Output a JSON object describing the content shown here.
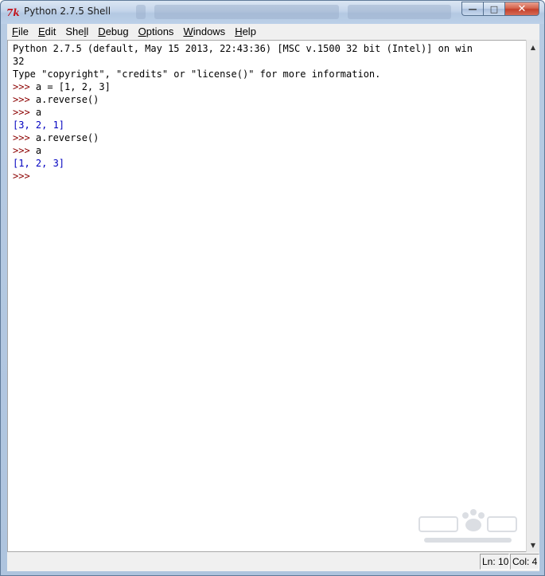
{
  "window": {
    "title": "Python 2.7.5 Shell",
    "icon": "tk-icon"
  },
  "menu": {
    "items": [
      {
        "label": "File",
        "mnemonic": "F",
        "rest": "ile"
      },
      {
        "label": "Edit",
        "mnemonic": "E",
        "rest": "dit"
      },
      {
        "label": "Shell",
        "pre": "She",
        "mnemonic": "l",
        "rest": "l"
      },
      {
        "label": "Debug",
        "mnemonic": "D",
        "rest": "ebug"
      },
      {
        "label": "Options",
        "mnemonic": "O",
        "rest": "ptions"
      },
      {
        "label": "Windows",
        "mnemonic": "W",
        "rest": "indows"
      },
      {
        "label": "Help",
        "mnemonic": "H",
        "rest": "elp"
      }
    ]
  },
  "shell": {
    "lines": [
      {
        "kind": "banner",
        "text": "Python 2.7.5 (default, May 15 2013, 22:43:36) [MSC v.1500 32 bit (Intel)] on win"
      },
      {
        "kind": "banner",
        "text": "32"
      },
      {
        "kind": "banner",
        "text": "Type \"copyright\", \"credits\" or \"license()\" for more information."
      },
      {
        "kind": "input",
        "prompt": ">>> ",
        "text": "a = [1, 2, 3]"
      },
      {
        "kind": "input",
        "prompt": ">>> ",
        "text": "a.reverse()"
      },
      {
        "kind": "input",
        "prompt": ">>> ",
        "text": "a"
      },
      {
        "kind": "output",
        "text": "[3, 2, 1]"
      },
      {
        "kind": "input",
        "prompt": ">>> ",
        "text": "a.reverse()"
      },
      {
        "kind": "input",
        "prompt": ">>> ",
        "text": "a"
      },
      {
        "kind": "output",
        "text": "[1, 2, 3]"
      },
      {
        "kind": "input",
        "prompt": ">>> ",
        "text": ""
      }
    ]
  },
  "status": {
    "line": "Ln: 10",
    "column": "Col: 4"
  },
  "colors": {
    "prompt": "#8b0000",
    "output": "#0000c0",
    "title_bar": "#c3d4ea"
  }
}
